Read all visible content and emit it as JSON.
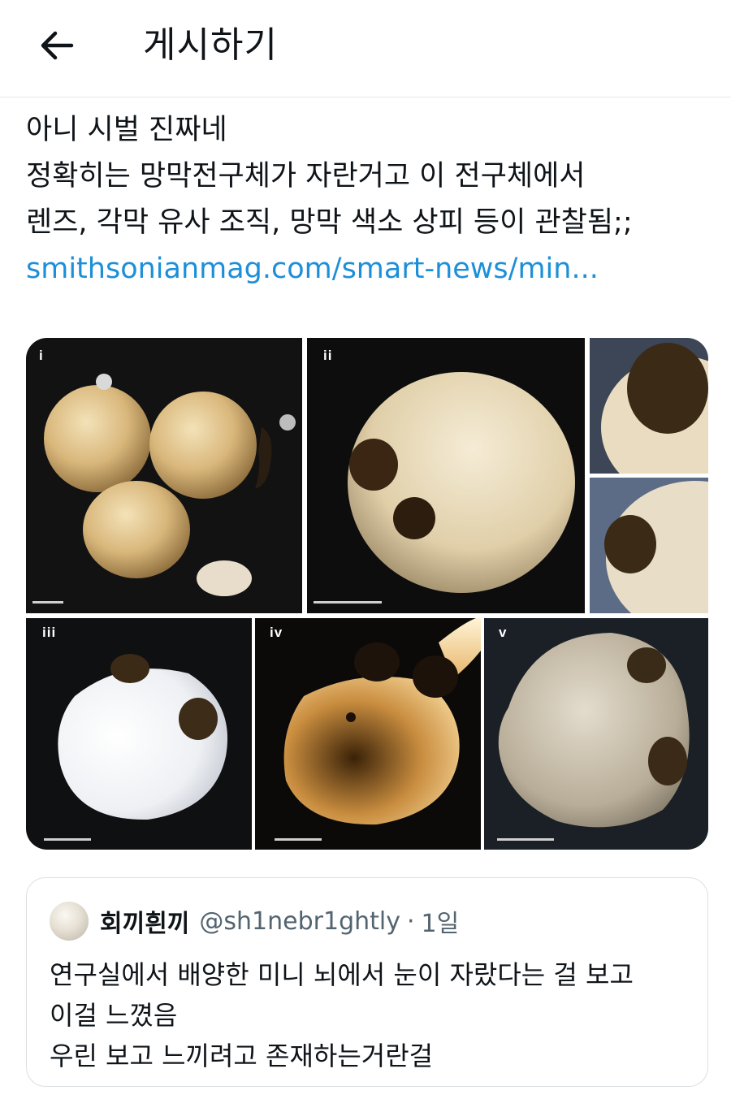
{
  "header": {
    "back_icon": "arrow-left-icon",
    "title": "게시하기"
  },
  "post": {
    "lines": [
      "아니 시벌 진짜네",
      "정확히는 망막전구체가 자란거고 이 전구체에서",
      "렌즈, 각막 유사 조직, 망막 색소 상피 등이 관찰됨;;"
    ],
    "link": "smithsonianmag.com/smart-news/min..."
  },
  "media": {
    "panel_labels": [
      "i",
      "ii",
      "iii",
      "iv",
      "v"
    ]
  },
  "quote": {
    "avatar": "avatar-image",
    "name": "회끼흰끼",
    "handle": "@sh1nebr1ghtly",
    "separator": "·",
    "time": "1일",
    "lines": [
      "연구실에서 배양한 미니 뇌에서 눈이 자랐다는 걸 보고",
      "이걸 느꼈음",
      "우린 보고 느끼려고 존재하는거란걸"
    ]
  }
}
